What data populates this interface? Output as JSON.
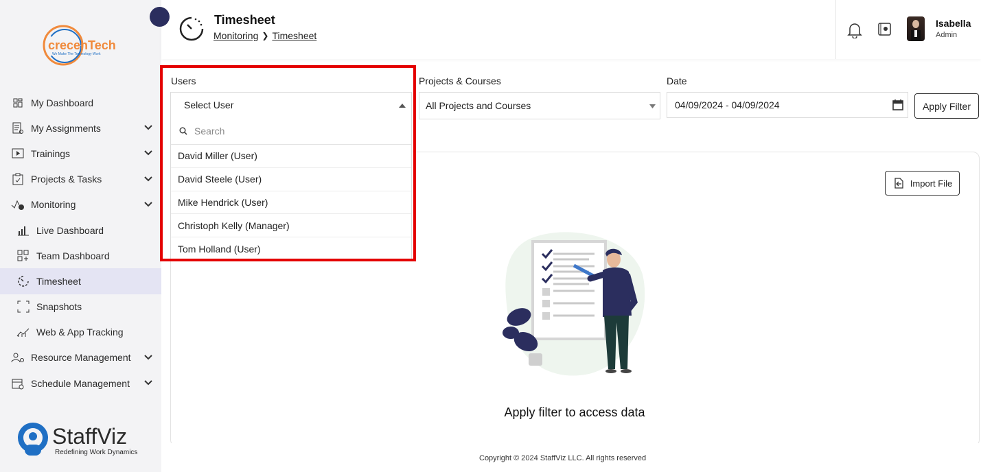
{
  "brand": {
    "top_logo": "crecenTech",
    "top_tagline": "We Make The Technology Work",
    "bottom_logo": "StaffViz",
    "bottom_tagline": "Redefining Work Dynamics"
  },
  "sidebar": {
    "items": [
      {
        "label": "My Dashboard",
        "icon": "grid-icon",
        "expandable": false
      },
      {
        "label": "My Assignments",
        "icon": "assignment-icon",
        "expandable": true
      },
      {
        "label": "Trainings",
        "icon": "play-icon",
        "expandable": true
      },
      {
        "label": "Projects & Tasks",
        "icon": "clipboard-icon",
        "expandable": true
      },
      {
        "label": "Monitoring",
        "icon": "monitoring-icon",
        "expandable": true
      },
      {
        "label": "Live Dashboard",
        "icon": "bar-chart-icon",
        "sub": true
      },
      {
        "label": "Team Dashboard",
        "icon": "team-grid-icon",
        "sub": true
      },
      {
        "label": "Timesheet",
        "icon": "timer-icon",
        "sub": true,
        "active": true
      },
      {
        "label": "Snapshots",
        "icon": "snapshot-icon",
        "sub": true
      },
      {
        "label": "Web & App Tracking",
        "icon": "tracking-icon",
        "sub": true
      },
      {
        "label": "Resource Management",
        "icon": "resource-icon",
        "expandable": true
      },
      {
        "label": "Schedule Management",
        "icon": "calendar-icon",
        "expandable": true
      }
    ]
  },
  "header": {
    "title": "Timesheet",
    "breadcrumb": [
      "Monitoring",
      "Timesheet"
    ],
    "user": {
      "name": "Isabella",
      "role": "Admin"
    }
  },
  "filters": {
    "users_label": "Users",
    "users_value": "Select User",
    "projects_label": "Projects & Courses",
    "projects_value": "All Projects and Courses",
    "date_label": "Date",
    "date_value": "04/09/2024 - 04/09/2024",
    "apply_label": "Apply Filter"
  },
  "dropdown": {
    "search_placeholder": "Search",
    "options": [
      "David Miller (User)",
      "David Steele (User)",
      "Mike Hendrick (User)",
      "Christoph Kelly (Manager)",
      "Tom Holland (User)"
    ]
  },
  "content": {
    "import_label": "Import File",
    "empty_message": "Apply filter to access data"
  },
  "footer": {
    "text": "Copyright © 2024 StaffViz LLC. All rights reserved"
  },
  "colors": {
    "accent": "#2b2e5e",
    "highlight": "#e40000",
    "active_bg": "#e4e4f3",
    "brand_orange": "#f08a3c",
    "brand_blue": "#1f6fc4"
  }
}
